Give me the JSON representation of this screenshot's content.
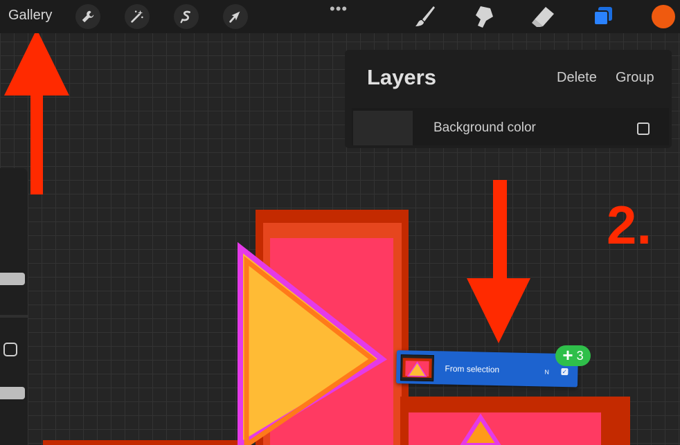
{
  "toolbar": {
    "gallery_label": "Gallery",
    "tools": [
      "wrench-icon",
      "magic-wand-icon",
      "selection-icon",
      "transform-arrow-icon"
    ],
    "more_label": "•••",
    "right_tools": [
      "brush-icon",
      "smudge-icon",
      "eraser-icon",
      "layers-icon"
    ],
    "current_color": "#ef5a0f"
  },
  "layers_panel": {
    "title": "Layers",
    "delete_label": "Delete",
    "group_label": "Group",
    "background_row": {
      "label": "Background color",
      "checked": false
    }
  },
  "dragged_layer": {
    "name": "From selection",
    "blend_mode": "N",
    "visible": true,
    "selection_badge": {
      "symbol": "+",
      "count": "3"
    }
  },
  "annotation": {
    "step_label": "2.",
    "color": "#ff2a00"
  },
  "colors": {
    "canvas": "#252525",
    "accent_blue": "#1d63cf",
    "badge_green": "#2fbf4a"
  }
}
